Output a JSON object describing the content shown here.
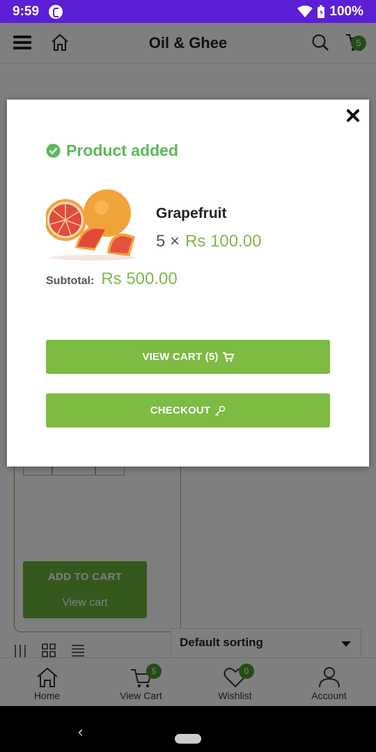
{
  "status_bar": {
    "time": "9:59",
    "battery": "100%"
  },
  "header": {
    "title": "Oil & Ghee",
    "cart_count": "5"
  },
  "background": {
    "add_to_cart_label": "ADD TO CART",
    "view_cart_link": "View cart",
    "sort_label": "Default sorting"
  },
  "bottom_nav": {
    "items": [
      {
        "label": "Home",
        "icon": "home-icon"
      },
      {
        "label": "View Cart",
        "icon": "cart-icon",
        "badge": "5"
      },
      {
        "label": "Wishlist",
        "icon": "heart-icon",
        "badge": "0"
      },
      {
        "label": "Account",
        "icon": "user-icon"
      }
    ]
  },
  "modal": {
    "status": "Product added",
    "product_name": "Grapefruit",
    "quantity": "5 ×",
    "unit_price": "Rs 100.00",
    "subtotal_label": "Subtotal:",
    "subtotal_value": "Rs 500.00",
    "view_cart_button": "VIEW CART (5)",
    "checkout_button": "CHECKOUT"
  },
  "colors": {
    "status_bar": "#5b1fd6",
    "accent_green": "#7dbb42",
    "success": "#5cb85c",
    "price": "#7fb74c"
  }
}
